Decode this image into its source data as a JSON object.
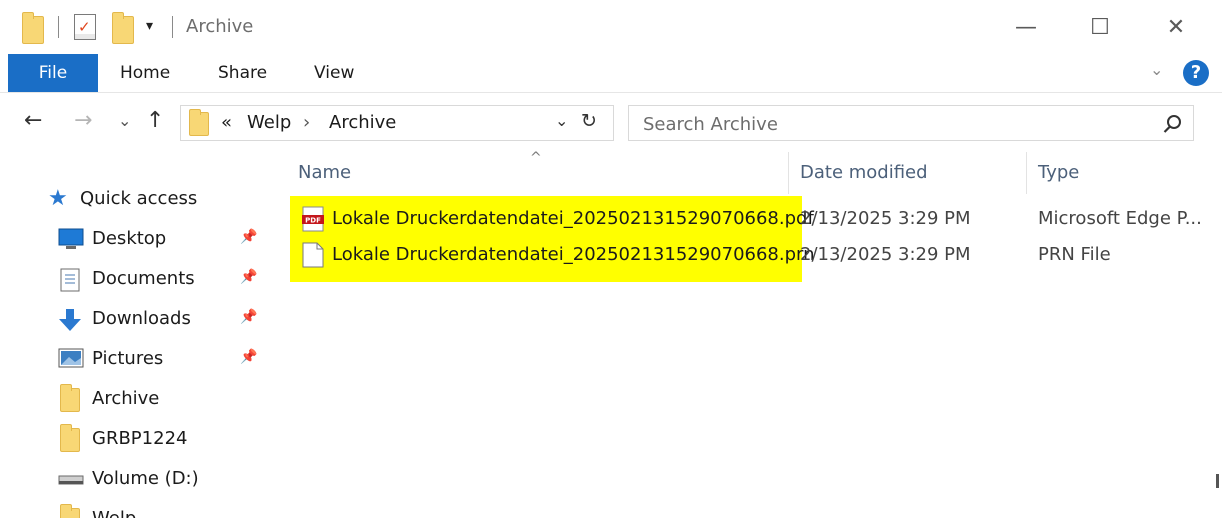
{
  "window": {
    "title": "Archive",
    "minimize_glyph": "—",
    "maximize_glyph": "☐",
    "close_glyph": "✕"
  },
  "quick_access_toolbar": {
    "items": [
      "folder-icon",
      "properties-icon",
      "new-folder-icon",
      "customize-dropdown-icon"
    ]
  },
  "ribbon": {
    "file_tab": "File",
    "tabs": [
      "Home",
      "Share",
      "View"
    ],
    "help_label": "?",
    "accent_color": "#1a6ec6"
  },
  "navigation": {
    "back": "←",
    "forward": "→",
    "recent_dropdown": "⌄",
    "up": "↑",
    "address": {
      "overflow": "«",
      "crumbs": [
        "Welp",
        "Archive"
      ],
      "separator": "›",
      "dropdown": "⌄",
      "refresh": "↻"
    },
    "search": {
      "placeholder": "Search Archive",
      "value": ""
    }
  },
  "sidebar": {
    "items": [
      {
        "label": "Quick access",
        "icon": "star-icon",
        "pinned": false
      },
      {
        "label": "Desktop",
        "icon": "desktop-icon",
        "pinned": true
      },
      {
        "label": "Documents",
        "icon": "documents-icon",
        "pinned": true
      },
      {
        "label": "Downloads",
        "icon": "downloads-icon",
        "pinned": true
      },
      {
        "label": "Pictures",
        "icon": "pictures-icon",
        "pinned": true
      },
      {
        "label": "Archive",
        "icon": "folder-icon",
        "pinned": false
      },
      {
        "label": "GRBP1224",
        "icon": "folder-icon",
        "pinned": false
      },
      {
        "label": "Volume (D:)",
        "icon": "drive-icon",
        "pinned": false
      },
      {
        "label": "Welp",
        "icon": "folder-icon",
        "pinned": false
      }
    ],
    "pin_glyph": "📌"
  },
  "file_list": {
    "columns": [
      "Name",
      "Date modified",
      "Type"
    ],
    "sort_indicator": "^",
    "highlight_color": "#ffff00",
    "rows": [
      {
        "name": "Lokale Druckerdatendatei_202502131529070668.pdf",
        "date": "2/13/2025 3:29 PM",
        "type": "Microsoft Edge P...",
        "icon": "pdf-icon"
      },
      {
        "name": "Lokale Druckerdatendatei_202502131529070668.prn",
        "date": "2/13/2025 3:29 PM",
        "type": "PRN File",
        "icon": "blank-file-icon"
      }
    ]
  }
}
